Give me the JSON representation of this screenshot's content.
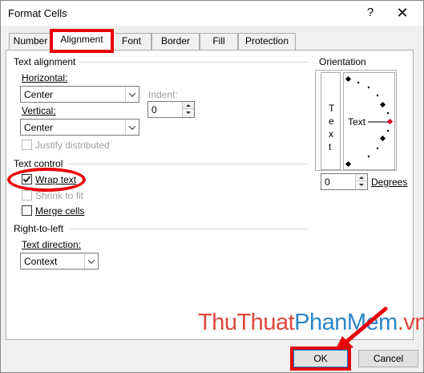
{
  "dialog": {
    "title": "Format Cells",
    "help_label": "?",
    "close_label": "✕"
  },
  "tabs": [
    {
      "label": "Number"
    },
    {
      "label": "Alignment"
    },
    {
      "label": "Font"
    },
    {
      "label": "Border"
    },
    {
      "label": "Fill"
    },
    {
      "label": "Protection"
    }
  ],
  "text_alignment": {
    "group_label": "Text alignment",
    "horizontal_label": "Horizontal:",
    "horizontal_value": "Center",
    "vertical_label": "Vertical:",
    "vertical_value": "Center",
    "indent_label": "Indent:",
    "indent_value": "0",
    "justify_label": "Justify distributed"
  },
  "text_control": {
    "group_label": "Text control",
    "wrap_text_label": "Wrap text",
    "wrap_text_checked": true,
    "shrink_label": "Shrink to fit",
    "merge_label": "Merge cells"
  },
  "rtl": {
    "group_label": "Right-to-left",
    "direction_label": "Text direction:",
    "direction_value": "Context"
  },
  "orientation": {
    "group_label": "Orientation",
    "vertical_letters": [
      "T",
      "e",
      "x",
      "t"
    ],
    "dial_text": "Text",
    "degrees_value": "0",
    "degrees_label": "Degrees"
  },
  "watermark": {
    "part1": "ThuThuat",
    "part2": "PhanMem",
    "part3": ".vn"
  },
  "buttons": {
    "ok_label": "OK",
    "cancel_label": "Cancel"
  },
  "colors": {
    "highlight": "#e8000b",
    "watermark_red": "#e0473d",
    "watermark_blue": "#2a86c8"
  }
}
